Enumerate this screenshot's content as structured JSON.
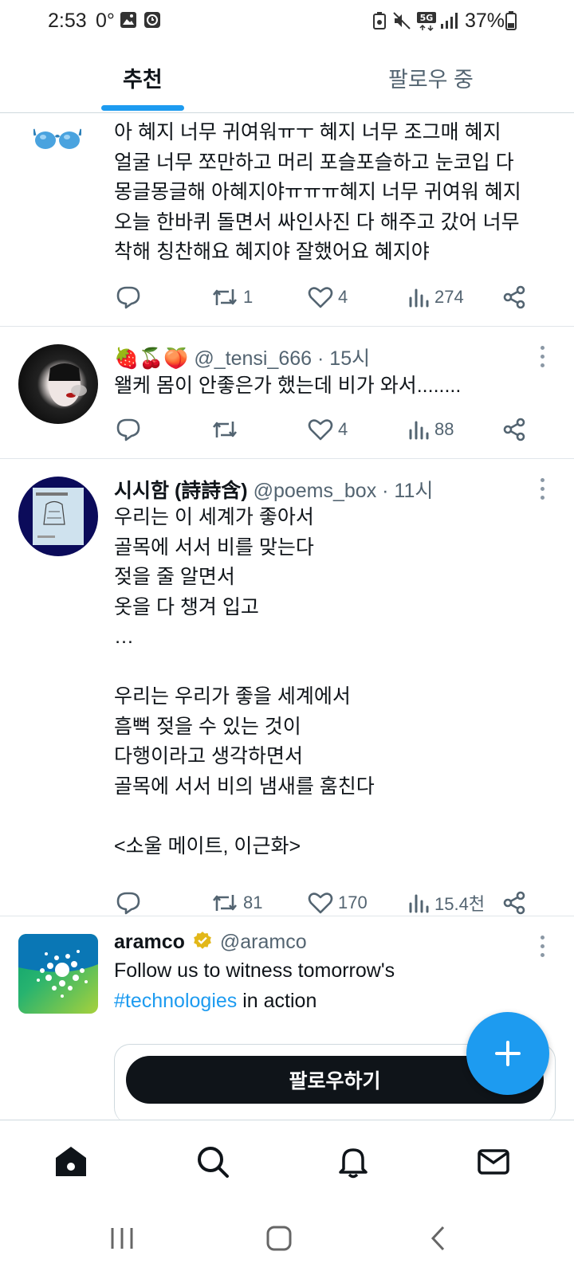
{
  "status_bar": {
    "time": "2:53",
    "temperature": "0°",
    "battery": "37%",
    "icons": [
      "gallery-icon",
      "clock-app-icon",
      "recycle-icon",
      "mute-icon",
      "5g-icon",
      "signal-icon",
      "battery-icon"
    ]
  },
  "tabs": [
    {
      "label": "추천",
      "active": true
    },
    {
      "label": "팔로우 중",
      "active": false
    }
  ],
  "accent_color": "#1d9bf0",
  "tweets": [
    {
      "text": "아 혜지 너무 귀여워ㅠㅜ 혜지 너무 조그매 혜지\n얼굴 너무 쪼만하고 머리 포슬포슬하고 눈코입 다\n몽글몽글해 아혜지야ㅠㅠㅠ혜지 너무 귀여워 혜지\n오늘 한바퀴 돌면서 싸인사진 다 해주고 갔어 너무\n착해 칭찬해요 혜지야 잘했어요 혜지야",
      "retweets": "1",
      "likes": "4",
      "views": "274"
    },
    {
      "name": "🍓🍒🍑",
      "handle": "@_tensi_666",
      "time": "· 15시",
      "text": "왤케 몸이 안좋은가 했는데 비가 와서........",
      "retweets": "",
      "likes": "4",
      "views": "88"
    },
    {
      "name": "시시함 (詩詩含)",
      "handle": "@poems_box",
      "time": "· 11시",
      "text": "우리는 이 세계가 좋아서\n골목에 서서 비를 맞는다\n젖을 줄 알면서\n옷을 다 챙겨 입고\n…\n\n우리는 우리가 좋을 세계에서\n흠뻑 젖을 수 있는 것이\n다행이라고 생각하면서\n골목에 서서 비의 냄새를 훔친다\n\n<소울 메이트, 이근화>",
      "retweets": "81",
      "likes": "170",
      "views": "15.4천"
    },
    {
      "name": "aramco",
      "handle": "@aramco",
      "text_before": "Follow us to witness tomorrow's",
      "hashtag": "#technologies",
      "text_after": " in action",
      "follow_label": "팔로우하기"
    }
  ],
  "bottom_nav": [
    "home-icon",
    "search-icon",
    "notifications-icon",
    "messages-icon"
  ]
}
